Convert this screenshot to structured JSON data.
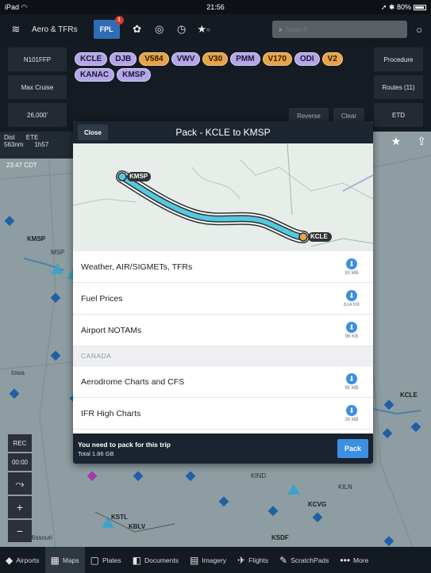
{
  "status": {
    "left": "iPad",
    "wifi_icon": "wifi-icon",
    "time": "21:56",
    "battery": "80%"
  },
  "toolbar": {
    "layers_icon": "layers-icon",
    "layers_label": "Aero & TFRs",
    "fpl_label": "FPL",
    "fpl_badge": "1",
    "icons": [
      "gear-icon",
      "gauge-icon",
      "clock-icon",
      "star-icon"
    ],
    "search_placeholder": "Search",
    "settings_icon": "settings-icon"
  },
  "route": {
    "left_cells": [
      "N101FFP",
      "Max Cruise",
      "26,000'"
    ],
    "right_cells": [
      "Procedure",
      "Routes (11)",
      "ETD"
    ],
    "waypoints": [
      {
        "label": "KCLE",
        "kind": "apt"
      },
      {
        "label": "DJB",
        "kind": "apt"
      },
      {
        "label": "V584",
        "kind": "fix"
      },
      {
        "label": "VWV",
        "kind": "apt"
      },
      {
        "label": "V30",
        "kind": "fix"
      },
      {
        "label": "PMM",
        "kind": "apt"
      },
      {
        "label": "V170",
        "kind": "fix"
      },
      {
        "label": "ODI",
        "kind": "apt"
      },
      {
        "label": "V2",
        "kind": "fix"
      },
      {
        "label": "KANAC",
        "kind": "apt"
      },
      {
        "label": "KMSP",
        "kind": "apt"
      }
    ],
    "reverse": "Reverse",
    "clear": "Clear"
  },
  "map": {
    "info_dist_label": "Dist",
    "info_dist_value": "563nm",
    "info_ete_label": "ETE",
    "info_ete_value": "1h57",
    "zulu": "23:47 CDT",
    "labels": [
      {
        "text": "KMSP"
      },
      {
        "text": "MSP"
      },
      {
        "text": "Iowa"
      },
      {
        "text": "KCLE"
      },
      {
        "text": "KIND"
      },
      {
        "text": "KCVG"
      },
      {
        "text": "KSTL"
      },
      {
        "text": "KBLV"
      },
      {
        "text": "KSDF"
      },
      {
        "text": "Missouri"
      },
      {
        "text": "KILN"
      }
    ],
    "left_controls": [
      "REC",
      "00:00"
    ],
    "star_icon": "star-icon",
    "share_icon": "share-icon"
  },
  "modal": {
    "close": "Close",
    "title": "Pack - KCLE to KMSP",
    "route_from": "KMSP",
    "route_to": "KCLE",
    "rows": [
      {
        "label": "Weather, AIR/SIGMETs, TFRs",
        "size": "93 MB"
      },
      {
        "label": "Fuel Prices",
        "size": "614 KB"
      },
      {
        "label": "Airport NOTAMs",
        "size": "96 KB"
      }
    ],
    "section": "CANADA",
    "canada_rows": [
      {
        "label": "Aerodrome Charts and CFS",
        "size": "95 MB"
      },
      {
        "label": "IFR High Charts",
        "size": "39 MB"
      }
    ],
    "footer_line1": "You need to pack for this trip",
    "footer_line2": "Total 1.86 GB",
    "pack": "Pack"
  },
  "tabs": [
    {
      "label": "Airports",
      "icon": "airport-icon",
      "glyph": "◆"
    },
    {
      "label": "Maps",
      "icon": "map-icon",
      "glyph": "▦"
    },
    {
      "label": "Plates",
      "icon": "plates-icon",
      "glyph": "▢"
    },
    {
      "label": "Documents",
      "icon": "documents-icon",
      "glyph": "◧"
    },
    {
      "label": "Imagery",
      "icon": "imagery-icon",
      "glyph": "▤"
    },
    {
      "label": "Flights",
      "icon": "flights-icon",
      "glyph": "✈"
    },
    {
      "label": "ScratchPads",
      "icon": "scratchpad-icon",
      "glyph": "✎"
    },
    {
      "label": "More",
      "icon": "more-icon",
      "glyph": "•••"
    }
  ],
  "colors": {
    "accent": "#3c8fe2",
    "route_line": "#56c8de",
    "airport_chip": "#b3a6e8",
    "airway_chip": "#e6a447"
  }
}
